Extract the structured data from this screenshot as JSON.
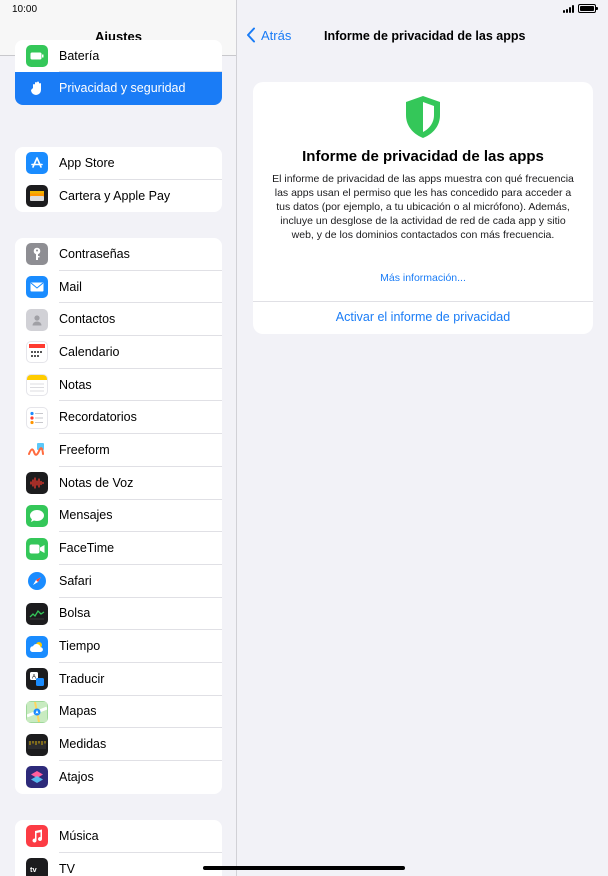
{
  "status": {
    "time": "10:00"
  },
  "sidebar": {
    "title": "Ajustes",
    "groups": [
      {
        "items": [
          {
            "label": "Batería",
            "icon": "battery-icon",
            "color": "#34c759"
          },
          {
            "label": "Privacidad y seguridad",
            "icon": "hand-icon",
            "color": "#1a7cf6",
            "selected": true
          }
        ]
      },
      {
        "items": [
          {
            "label": "App Store",
            "icon": "app-store-icon",
            "color": "#1a8cff"
          },
          {
            "label": "Cartera y Apple Pay",
            "icon": "wallet-icon",
            "color": "#1c1c1e"
          }
        ]
      },
      {
        "items": [
          {
            "label": "Contraseñas",
            "icon": "key-icon",
            "color": "#8e8e93"
          },
          {
            "label": "Mail",
            "icon": "mail-icon",
            "color": "#1a8cff"
          },
          {
            "label": "Contactos",
            "icon": "contacts-icon",
            "color": "#c7c7cc"
          },
          {
            "label": "Calendario",
            "icon": "calendar-icon",
            "color": "#ffffff"
          },
          {
            "label": "Notas",
            "icon": "notes-icon",
            "color": "#ffffff"
          },
          {
            "label": "Recordatorios",
            "icon": "reminders-icon",
            "color": "#ffffff"
          },
          {
            "label": "Freeform",
            "icon": "freeform-icon",
            "color": "#ffffff"
          },
          {
            "label": "Notas de Voz",
            "icon": "voice-memos-icon",
            "color": "#1c1c1e"
          },
          {
            "label": "Mensajes",
            "icon": "messages-icon",
            "color": "#34c759"
          },
          {
            "label": "FaceTime",
            "icon": "facetime-icon",
            "color": "#34c759"
          },
          {
            "label": "Safari",
            "icon": "safari-icon",
            "color": "#ffffff"
          },
          {
            "label": "Bolsa",
            "icon": "stocks-icon",
            "color": "#1c1c1e"
          },
          {
            "label": "Tiempo",
            "icon": "weather-icon",
            "color": "#1a8cff"
          },
          {
            "label": "Traducir",
            "icon": "translate-icon",
            "color": "#1c1c1e"
          },
          {
            "label": "Mapas",
            "icon": "maps-icon",
            "color": "#9fd89a"
          },
          {
            "label": "Medidas",
            "icon": "measure-icon",
            "color": "#1c1c1e"
          },
          {
            "label": "Atajos",
            "icon": "shortcuts-icon",
            "color": "#3a3aa8"
          }
        ]
      },
      {
        "items": [
          {
            "label": "Música",
            "icon": "music-icon",
            "color": "#fc3c44"
          },
          {
            "label": "TV",
            "icon": "tv-icon",
            "color": "#1c1c1e"
          }
        ]
      }
    ]
  },
  "detail": {
    "back_label": "Atrás",
    "nav_title": "Informe de privacidad de las apps",
    "card": {
      "icon": "shield-icon",
      "accent": "#34c759",
      "title": "Informe de privacidad de las apps",
      "description": "El informe de privacidad de las apps muestra con qué frecuencia las apps usan el permiso que les has concedido para acceder a tus datos (por ejemplo, a tu ubicación o al micrófono). Además, incluye un desglose de la actividad de red de cada app y sitio web, y de los dominios contactados con más frecuencia.",
      "more_link": "Más información...",
      "activate_label": "Activar el informe de privacidad"
    }
  }
}
